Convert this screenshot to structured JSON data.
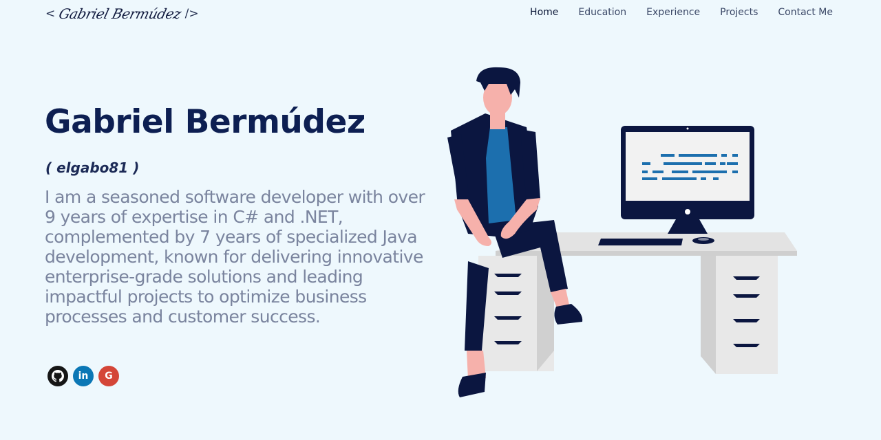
{
  "logo": {
    "open_bracket": "<",
    "signature": "Gabriel Bermúdez",
    "close_bracket": "/>"
  },
  "nav": {
    "items": [
      {
        "label": "Home",
        "active": true
      },
      {
        "label": "Education",
        "active": false
      },
      {
        "label": "Experience",
        "active": false
      },
      {
        "label": "Projects",
        "active": false
      },
      {
        "label": "Contact Me",
        "active": false
      }
    ]
  },
  "hero": {
    "name": "Gabriel Bermúdez",
    "handle": "( elgabo81 )",
    "bio": "I am a seasoned software developer with over 9 years of expertise in C# and .NET, complemented by 7 years of specialized Java development, known for delivering innovative enterprise-grade solutions and leading impactful projects to optimize business processes and customer success."
  },
  "socials": [
    {
      "icon": "github-icon",
      "color": "#161616"
    },
    {
      "icon": "linkedin-icon",
      "glyph": "in",
      "color": "#0b77b5"
    },
    {
      "icon": "google-icon",
      "glyph": "G",
      "color": "#d44638"
    }
  ],
  "colors": {
    "background": "#eef8fd",
    "heading": "#0d1f52",
    "bio_text": "#7a849e",
    "illustration_navy": "#0b1640",
    "illustration_blue": "#1c6fae"
  }
}
